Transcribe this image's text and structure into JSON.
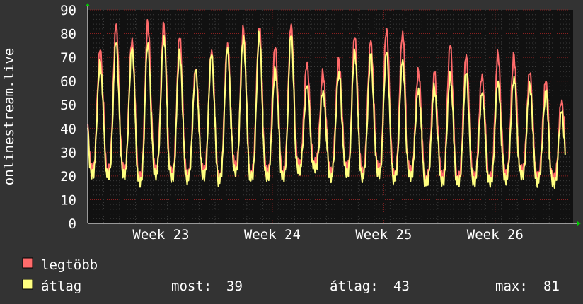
{
  "chart_data": {
    "type": "line",
    "ylabel": "onlinestream.live",
    "ylim": [
      0,
      90
    ],
    "y_ticks": [
      0,
      10,
      20,
      30,
      40,
      50,
      60,
      70,
      80,
      90
    ],
    "grid": true,
    "x_tick_labels": [
      "Week 23",
      "Week 24",
      "Week 25",
      "Week 26"
    ],
    "x_tick_positions_day": [
      4.6,
      11.6,
      18.6,
      25.6
    ],
    "x_range_days": [
      0,
      30.5
    ],
    "series": [
      {
        "name": "legtöbb",
        "color": "#ff6b6b",
        "daily_peaks": [
          73,
          84,
          78,
          84,
          84,
          78,
          65,
          73,
          76,
          82,
          82,
          74,
          84,
          68,
          63,
          69,
          78,
          77,
          82,
          81,
          64,
          63,
          75,
          71,
          63,
          71,
          71,
          63,
          60,
          52
        ],
        "daily_troughs": [
          23,
          22,
          23,
          19,
          23,
          21,
          21,
          22,
          20,
          24,
          21,
          22,
          21,
          25,
          25,
          22,
          23,
          22,
          23,
          21,
          22,
          19,
          20,
          19,
          20,
          19,
          21,
          22,
          20,
          19
        ]
      },
      {
        "name": "átlag",
        "color": "#ffff80",
        "daily_peaks": [
          68,
          76,
          74,
          76,
          79,
          72,
          64,
          71,
          74,
          79,
          79,
          65,
          79,
          58,
          56,
          64,
          72,
          71,
          72,
          69,
          57,
          57,
          63,
          63,
          55,
          60,
          62,
          58,
          55,
          47
        ],
        "daily_troughs": [
          21,
          20,
          21,
          17,
          21,
          19,
          19,
          20,
          18,
          22,
          19,
          20,
          19,
          23,
          23,
          20,
          21,
          20,
          21,
          19,
          20,
          17,
          18,
          17,
          18,
          17,
          19,
          20,
          18,
          17
        ]
      }
    ],
    "legend": [
      {
        "label": "legtöbb",
        "color": "#ff6b6b"
      },
      {
        "label": "átlag",
        "color": "#ffff80"
      }
    ],
    "stats": {
      "now_label": "most:",
      "now_value": "39",
      "avg_label": "átlag:",
      "avg_value": "43",
      "max_label": "max:",
      "max_value": "81"
    }
  }
}
